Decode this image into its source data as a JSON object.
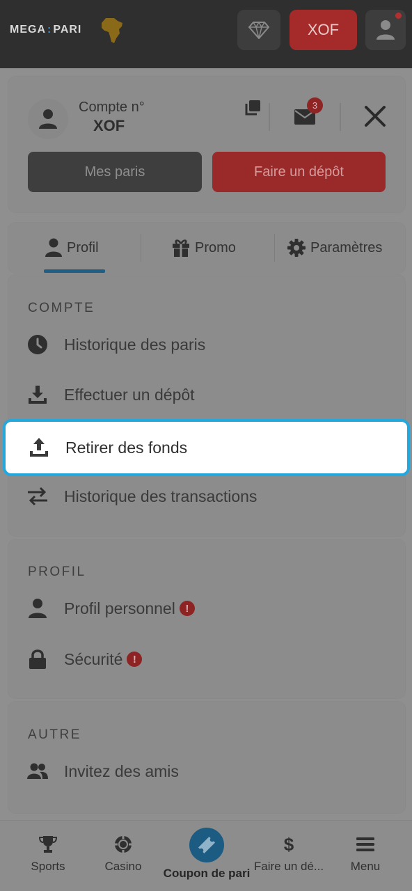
{
  "header": {
    "logo_left": "MEGA",
    "logo_sep": ":",
    "logo_right": "PARI",
    "currency_button": "XOF",
    "icons": {
      "diamond": "diamond-icon",
      "user": "user-icon",
      "africa": "africa-map-icon"
    }
  },
  "account": {
    "label": "Compte n°",
    "value": "XOF",
    "mail_badge": "3",
    "my_bets_label": "Mes paris",
    "deposit_label": "Faire un dépôt"
  },
  "tabs": [
    {
      "label": "Profil",
      "icon": "person-icon",
      "active": true
    },
    {
      "label": "Promo",
      "icon": "gift-icon",
      "active": false
    },
    {
      "label": "Paramètres",
      "icon": "gear-icon",
      "active": false
    }
  ],
  "sections": {
    "compte": {
      "title": "COMPTE",
      "items": [
        {
          "label": "Historique des paris",
          "icon": "clock-icon"
        },
        {
          "label": "Effectuer un dépôt",
          "icon": "download-icon"
        },
        {
          "label": "Retirer des fonds",
          "icon": "upload-icon",
          "highlighted": true
        },
        {
          "label": "Historique des transactions",
          "icon": "transfer-arrows-icon"
        }
      ]
    },
    "profil": {
      "title": "PROFIL",
      "items": [
        {
          "label": "Profil personnel",
          "icon": "person-icon",
          "warning": "!"
        },
        {
          "label": "Sécurité",
          "icon": "lock-icon",
          "warning": "!"
        }
      ]
    },
    "autre": {
      "title": "AUTRE",
      "items": [
        {
          "label": "Invitez des amis",
          "icon": "people-icon"
        }
      ]
    }
  },
  "bottom_nav": [
    {
      "label": "Sports",
      "icon": "trophy-icon"
    },
    {
      "label": "Casino",
      "icon": "casino-chip-icon"
    },
    {
      "label": "Coupon de pari",
      "icon": "ticket-icon",
      "active": true
    },
    {
      "label": "Faire un dé...",
      "icon": "dollar-icon"
    },
    {
      "label": "Menu",
      "icon": "hamburger-icon"
    }
  ],
  "colors": {
    "highlight_border": "#23a7dc",
    "brand_red": "#c53838",
    "accent_blue": "#1d5c82"
  }
}
